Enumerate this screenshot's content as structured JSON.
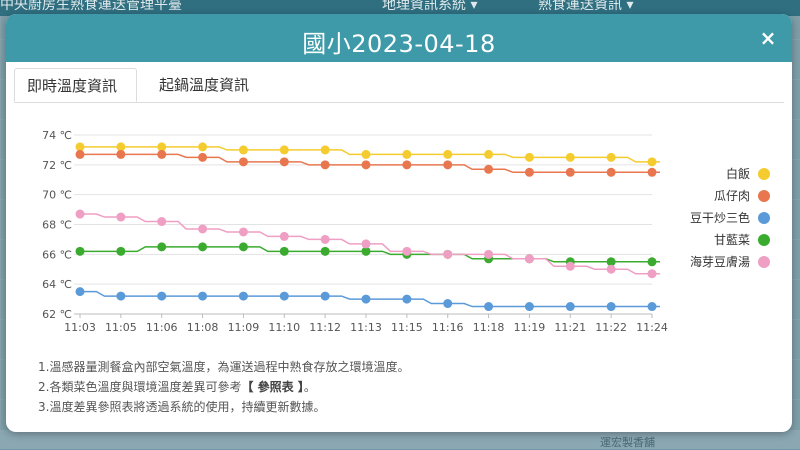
{
  "background": {
    "header_title": "中央廚房生熟食運送管理平臺",
    "nav": [
      "地理資訊系統 ▾",
      "熟食運送資訊 ▾"
    ],
    "road_labels": [
      "運宏製香舖"
    ]
  },
  "modal": {
    "title": "國小2023-04-18",
    "close_label": "×",
    "tabs": [
      {
        "label": "即時溫度資訊",
        "active": true
      },
      {
        "label": "起鍋溫度資訊",
        "active": false
      }
    ],
    "notes": {
      "line1": "1.溫感器量測餐盒內部空氣溫度，為運送過程中熟食存放之環境溫度。",
      "line2_prefix": "2.各類菜色溫度與環境溫度差異可參考",
      "line2_ref": "【 參照表 】",
      "line2_suffix": "。",
      "line3": "3.溫度差異參照表將透過系統的使用，持續更新數據。"
    }
  },
  "chart_data": {
    "type": "line",
    "title": "",
    "xlabel": "",
    "ylabel": "",
    "x": [
      "11:03",
      "11:05",
      "11:06",
      "11:08",
      "11:09",
      "11:10",
      "11:12",
      "11:13",
      "11:15",
      "11:16",
      "11:18",
      "11:19",
      "11:21",
      "11:22",
      "11:24"
    ],
    "ylim": [
      62,
      74
    ],
    "yticks": [
      62,
      64,
      66,
      68,
      70,
      72,
      74
    ],
    "ytick_labels": [
      "62 ℃",
      "64 ℃",
      "66 ℃",
      "68 ℃",
      "70 ℃",
      "72 ℃",
      "74 ℃"
    ],
    "grid": true,
    "legend_position": "right",
    "series": [
      {
        "name": "白飯",
        "color": "#f5cc2f",
        "values": [
          73.2,
          73.2,
          73.2,
          73.2,
          73.0,
          73.0,
          73.0,
          72.7,
          72.7,
          72.7,
          72.7,
          72.5,
          72.5,
          72.5,
          72.2
        ]
      },
      {
        "name": "瓜仔肉",
        "color": "#e8774f",
        "values": [
          72.7,
          72.7,
          72.7,
          72.5,
          72.2,
          72.2,
          72.0,
          72.0,
          72.0,
          72.0,
          71.7,
          71.5,
          71.5,
          71.5,
          71.5
        ]
      },
      {
        "name": "豆干炒三色",
        "color": "#5b9ad9",
        "values": [
          63.5,
          63.2,
          63.2,
          63.2,
          63.2,
          63.2,
          63.2,
          63.0,
          63.0,
          62.7,
          62.5,
          62.5,
          62.5,
          62.5,
          62.5
        ]
      },
      {
        "name": "甘藍菜",
        "color": "#3aab2f",
        "values": [
          66.2,
          66.2,
          66.5,
          66.5,
          66.5,
          66.2,
          66.2,
          66.2,
          66.0,
          66.0,
          65.7,
          65.7,
          65.5,
          65.5,
          65.5
        ]
      },
      {
        "name": "海芽豆膚湯",
        "color": "#ef9fc4",
        "values": [
          68.7,
          68.5,
          68.2,
          67.7,
          67.5,
          67.2,
          67.0,
          66.7,
          66.2,
          66.0,
          66.0,
          65.7,
          65.2,
          65.0,
          64.7
        ]
      }
    ]
  }
}
